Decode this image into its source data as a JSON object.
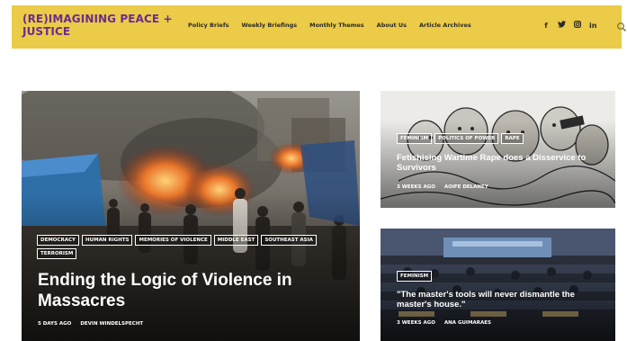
{
  "brand": {
    "name": "(RE)IMAGINING PEACE + JUSTICE",
    "primary_color": "#ebcb47",
    "accent_color": "#6b2c8f"
  },
  "nav": {
    "items": [
      {
        "label": "Policy Briefs"
      },
      {
        "label": "Weekly Briefings"
      },
      {
        "label": "Monthly Themes"
      },
      {
        "label": "About Us"
      },
      {
        "label": "Article Archives"
      }
    ]
  },
  "social": {
    "facebook": "f",
    "twitter": "✦",
    "instagram": "▣",
    "linkedin": "in"
  },
  "search": {
    "icon": "search-icon"
  },
  "articles": [
    {
      "tags": [
        "DEMOCRACY",
        "HUMAN RIGHTS",
        "MEMORIES OF VIOLENCE",
        "MIDDLE EAST",
        "SOUTHEAST ASIA",
        "TERRORISM"
      ],
      "title": "Ending the Logic of Violence in Massacres",
      "date": "5 DAYS AGO",
      "author": "DEVIN WINDELSPECHT"
    },
    {
      "tags": [
        "FEMINISM",
        "POLITICS OF POWER",
        "RAPE"
      ],
      "title": "Fetishising Wartime Rape does a Disservice to Survivors",
      "date": "3 WEEKS AGO",
      "author": "AOIFE DELANEY"
    },
    {
      "tags": [
        "FEMINISM"
      ],
      "title": "\"The master's tools will never dismantle the master's house.\"",
      "date": "3 WEEKS AGO",
      "author": "ANA GUIMARAES"
    }
  ]
}
